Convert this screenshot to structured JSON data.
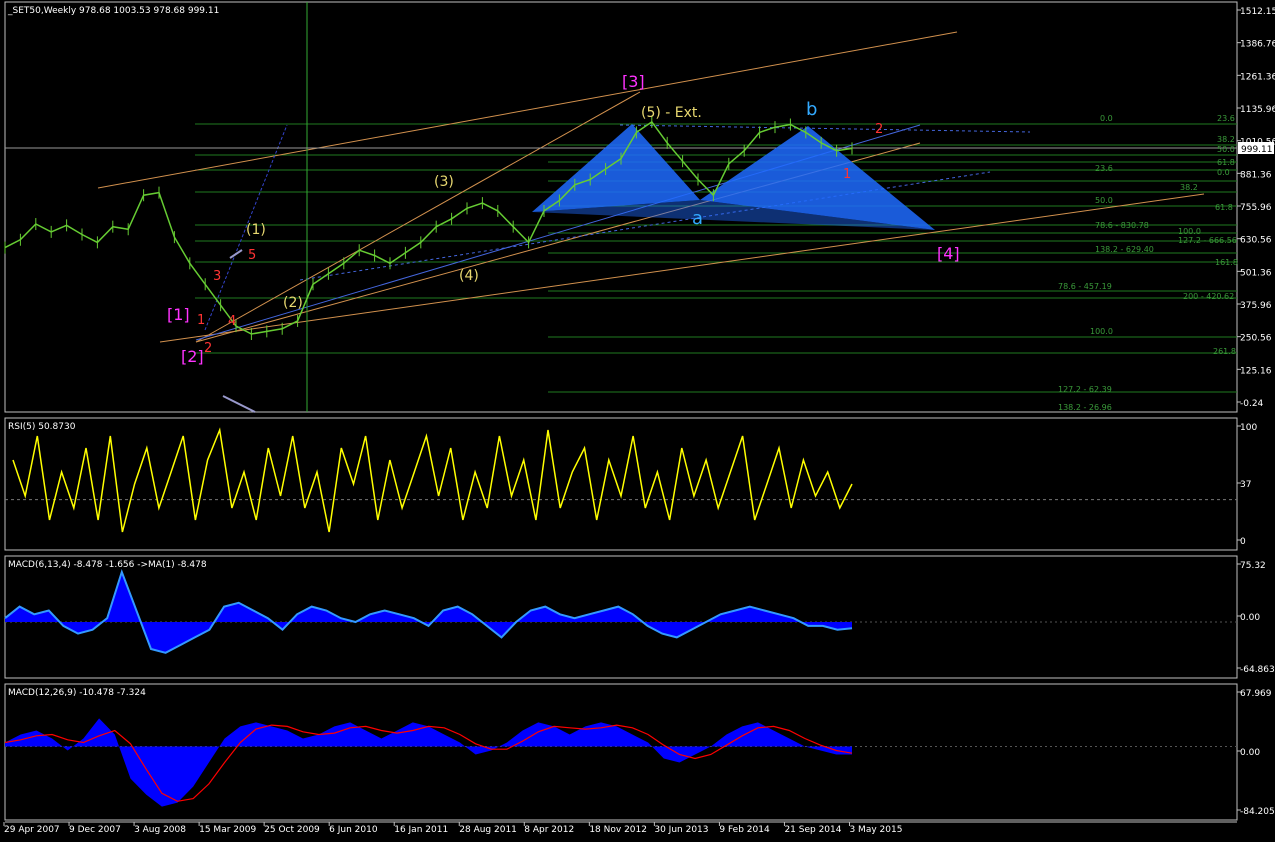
{
  "colors": {
    "background": "#000000",
    "frame": "#c0c0c0",
    "grid": "#404040",
    "price_bars": "#66cc33",
    "rsi": "#ffff00",
    "macd_hist": "#0000ff",
    "macd_line": "#3399ff",
    "signal_line": "#ff0000",
    "channel": "#d2914e",
    "fib": "#1f7a1f",
    "fib_text": "#3a9a3a",
    "pattern": "#1e6bff",
    "wave_primary": "#ff33ff",
    "wave_intermediate": "#e8d870",
    "wave_minor": "#ff3333",
    "wave_b": "#33aaff"
  },
  "chart_data": [
    {
      "type": "line",
      "name": "price",
      "title": "_SET50,Weekly  978.68 1003.53 978.68 999.11",
      "current_value": "999.11",
      "ylim": [
        -0.24,
        1512.15
      ],
      "y_ticks": [
        "1512.15",
        "1386.76",
        "1261.36",
        "1135.96",
        "1010.56",
        "881.36",
        "755.96",
        "630.56",
        "501.36",
        "375.96",
        "250.56",
        "125.16",
        "-0.24"
      ],
      "x_ticks": [
        "29 Apr 2007",
        "9 Dec 2007",
        "3 Aug 2008",
        "15 Mar 2009",
        "25 Oct 2009",
        "6 Jun 2010",
        "16 Jan 2011",
        "28 Aug 2011",
        "8 Apr 2012",
        "18 Nov 2012",
        "30 Jun 2013",
        "9 Feb 2014",
        "21 Sep 2014",
        "3 May 2015"
      ],
      "series": [
        {
          "name": "",
          "values": [
            620,
            650,
            710,
            680,
            705,
            670,
            640,
            700,
            690,
            820,
            830,
            660,
            560,
            480,
            400,
            320,
            290,
            300,
            310,
            340,
            480,
            520,
            560,
            610,
            590,
            560,
            600,
            640,
            700,
            730,
            770,
            790,
            760,
            700,
            640,
            760,
            800,
            860,
            880,
            920,
            960,
            1060,
            1100,
            1020,
            950,
            880,
            820,
            940,
            990,
            1060,
            1080,
            1090,
            1060,
            1020,
            990,
            999
          ]
        }
      ],
      "wave_labels": [
        {
          "text": "[1]",
          "color_key": "wave_primary"
        },
        {
          "text": "[2]",
          "color_key": "wave_primary"
        },
        {
          "text": "[3]",
          "color_key": "wave_primary"
        },
        {
          "text": "[4]",
          "color_key": "wave_primary"
        },
        {
          "text": "(1)",
          "color_key": "wave_intermediate"
        },
        {
          "text": "(2)",
          "color_key": "wave_intermediate"
        },
        {
          "text": "(3)",
          "color_key": "wave_intermediate"
        },
        {
          "text": "(4)",
          "color_key": "wave_intermediate"
        },
        {
          "text": "(5) - Ext.",
          "color_key": "wave_intermediate"
        },
        {
          "text": "1",
          "color_key": "wave_minor"
        },
        {
          "text": "2",
          "color_key": "wave_minor"
        },
        {
          "text": "3",
          "color_key": "wave_minor"
        },
        {
          "text": "4",
          "color_key": "wave_minor"
        },
        {
          "text": "5",
          "color_key": "wave_minor"
        },
        {
          "text": "2",
          "color_key": "wave_minor"
        },
        {
          "text": "1",
          "color_key": "wave_minor"
        },
        {
          "text": "a",
          "color_key": "wave_b"
        },
        {
          "text": "b",
          "color_key": "wave_b"
        }
      ],
      "fib_labels": [
        "0.0",
        "23.6",
        "38.2",
        "50.0",
        "61.8",
        "0.0",
        "23.6",
        "38.2",
        "50.0",
        "61.8",
        "78.6 - 830.78",
        "100.0",
        "127.2 - 666.56",
        "138.2 - 629.40",
        "161.8",
        "78.6 - 457.19",
        "200 - 420.62",
        "100.0",
        "261.8",
        "127.2 - 62.39",
        "138.2 - 26.96"
      ]
    },
    {
      "type": "line",
      "name": "rsi",
      "title": "RSI(5) 50.8730",
      "ylim": [
        0,
        100
      ],
      "y_ticks": [
        "100",
        "37",
        "0"
      ],
      "values": [
        70,
        40,
        90,
        20,
        60,
        30,
        80,
        20,
        90,
        10,
        50,
        80,
        30,
        60,
        90,
        20,
        70,
        95,
        30,
        60,
        20,
        80,
        40,
        90,
        30,
        60,
        10,
        80,
        50,
        90,
        20,
        70,
        30,
        60,
        90,
        40,
        80,
        20,
        60,
        30,
        90,
        40,
        70,
        20,
        95,
        30,
        60,
        80,
        20,
        70,
        40,
        90,
        30,
        60,
        20,
        80,
        40,
        70,
        30,
        60,
        90,
        20,
        50,
        80,
        30,
        70,
        40,
        60,
        30,
        50
      ]
    },
    {
      "type": "area",
      "name": "macd_fast",
      "title": "MACD(6,13,4) -8.478 -1.656  ->MA(1) -8.478",
      "ylim": [
        -64.863,
        75.32
      ],
      "y_ticks": [
        "75.32",
        "0.00",
        "-64.863"
      ],
      "values": [
        5,
        20,
        10,
        15,
        -5,
        -15,
        -10,
        5,
        65,
        15,
        -35,
        -40,
        -30,
        -20,
        -10,
        20,
        25,
        15,
        5,
        -10,
        10,
        20,
        15,
        5,
        0,
        10,
        15,
        10,
        5,
        -5,
        15,
        20,
        10,
        -5,
        -20,
        0,
        15,
        20,
        10,
        5,
        10,
        15,
        20,
        10,
        -5,
        -15,
        -20,
        -10,
        0,
        10,
        15,
        20,
        15,
        10,
        5,
        -5,
        -5,
        -10,
        -8
      ]
    },
    {
      "type": "area",
      "name": "macd_slow",
      "title": "MACD(12,26,9) -10.478 -7.324",
      "ylim": [
        -84.205,
        67.969
      ],
      "y_ticks": [
        "67.969",
        "0.00",
        "-84.205"
      ],
      "values": [
        5,
        15,
        20,
        10,
        -5,
        10,
        35,
        15,
        -40,
        -60,
        -75,
        -70,
        -50,
        -20,
        10,
        25,
        30,
        25,
        20,
        10,
        15,
        25,
        30,
        20,
        10,
        20,
        30,
        25,
        15,
        5,
        -10,
        -5,
        5,
        20,
        30,
        25,
        15,
        25,
        30,
        25,
        15,
        5,
        -15,
        -20,
        -10,
        0,
        15,
        25,
        30,
        20,
        10,
        0,
        -5,
        -10,
        -10
      ]
    }
  ]
}
